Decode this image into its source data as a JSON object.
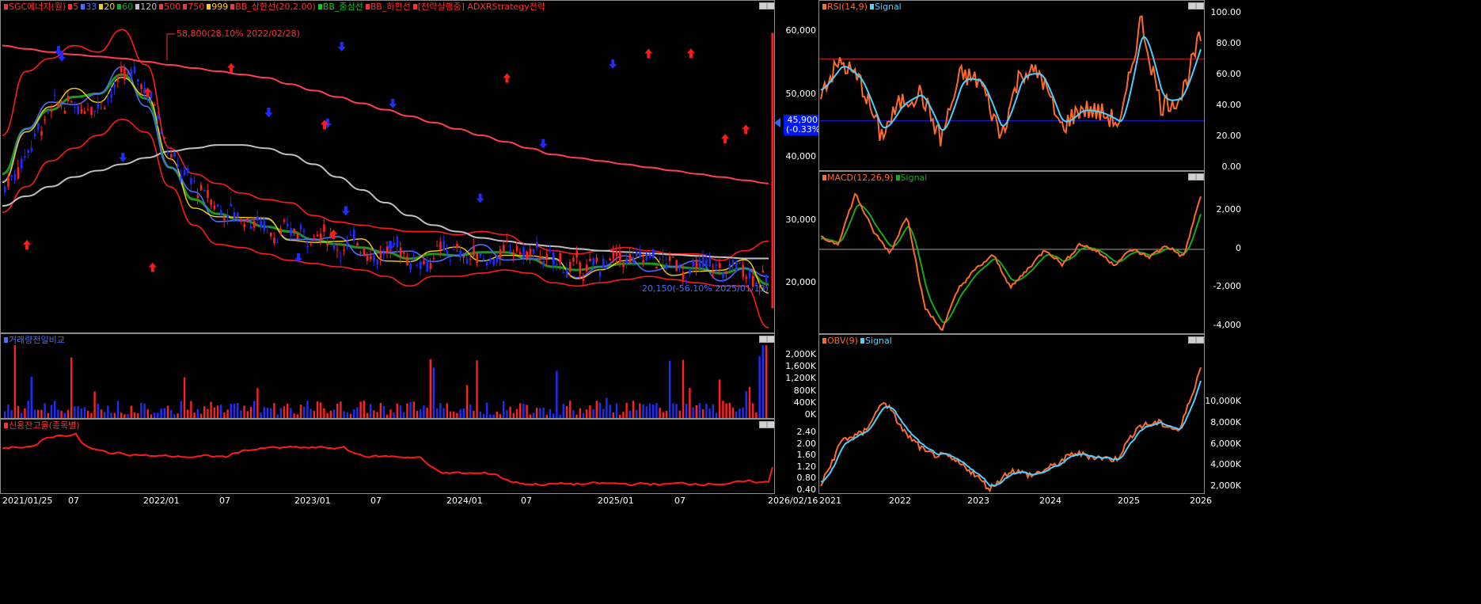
{
  "colors": {
    "up": "#ff2020",
    "down": "#1e2cff",
    "bb": "#ff1a1a",
    "grid_line": "#808080"
  },
  "price_panel": {
    "legend": [
      {
        "text": "SGC에너지(월)",
        "color": "#ff3030"
      },
      {
        "text": "5",
        "color": "#ff3030"
      },
      {
        "text": "33",
        "color": "#4a6bff"
      },
      {
        "text": "20",
        "color": "#ffd000"
      },
      {
        "text": "60",
        "color": "#18a818"
      },
      {
        "text": "120",
        "color": "#c0c0c0"
      },
      {
        "text": "500",
        "color": "#ff3030"
      },
      {
        "text": "750",
        "color": "#ff3030"
      },
      {
        "text": "999",
        "color": "#ffd000"
      },
      {
        "text": "BB_상한선(20,2.00)",
        "color": "#ff3030"
      },
      {
        "text": "BB_중심선",
        "color": "#18c818"
      },
      {
        "text": "BB_하한선",
        "color": "#ff3030"
      },
      {
        "text": "[전략실행중] ADXRStrategy전략",
        "color": "#ff3030"
      }
    ],
    "high_label": "58,800(28.10% 2022/02/28)",
    "low_label": "20,150(-56.10% 2025/01/13)",
    "current_price": "45,900",
    "current_change": "(-0.33%)",
    "y_ticks": [
      "60,000",
      "50,000",
      "40,000",
      "30,000",
      "20,000"
    ]
  },
  "volume_panel": {
    "legend": [
      {
        "text": "거래량전일비교",
        "color": "#4a6bff"
      }
    ],
    "y_ticks": [
      "2,000K",
      "1,600K",
      "1,200K",
      "800K",
      "400K",
      "0K"
    ]
  },
  "credit_panel": {
    "legend": [
      {
        "text": "신용잔고율(종목별)",
        "color": "#ff3030"
      }
    ],
    "y_ticks": [
      "2.40",
      "2.00",
      "1.60",
      "1.20",
      "0.80",
      "0.40"
    ]
  },
  "x_axis_left": [
    "2021/01/25",
    "07",
    "2022/01",
    "07",
    "2023/01",
    "07",
    "2024/01",
    "07",
    "2025/01",
    "07",
    "2026/02/16"
  ],
  "rsi_panel": {
    "legend": [
      {
        "text": "RSI(14,9)",
        "color": "#ff6a2a"
      },
      {
        "text": "Signal",
        "color": "#4ad0ff"
      }
    ],
    "y_ticks": [
      "100.00",
      "80.00",
      "60.00",
      "40.00",
      "20.00",
      "0.00"
    ]
  },
  "macd_panel": {
    "legend": [
      {
        "text": "MACD(12,26,9)",
        "color": "#ff6a2a"
      },
      {
        "text": "Signal",
        "color": "#18a818"
      }
    ],
    "y_ticks": [
      "2,000",
      "0",
      "-2,000",
      "-4,000"
    ]
  },
  "obv_panel": {
    "legend": [
      {
        "text": "OBV(9)",
        "color": "#ff6a2a"
      },
      {
        "text": "Signal",
        "color": "#4ad0ff"
      }
    ],
    "y_ticks": [
      "10,000K",
      "8,000K",
      "6,000K",
      "4,000K",
      "2,000K"
    ]
  },
  "x_axis_right": [
    "2021",
    "2022",
    "2023",
    "2024",
    "2025",
    "2026"
  ],
  "chart_data": [
    {
      "type": "line",
      "title": "SGC에너지(월)",
      "ylim": [
        13000,
        65000
      ],
      "series": [
        {
          "name": "BB_상한선(20,2.00)",
          "values": [
            44000,
            54000,
            56000,
            58000,
            57000,
            60500,
            55000,
            42000,
            38000,
            36500,
            35000,
            34000,
            33500,
            31500,
            30500,
            30000,
            29500,
            29000,
            29000,
            28500,
            29000,
            28500,
            27000,
            26000,
            25500,
            26000,
            26500,
            26000,
            25500,
            25500,
            24500,
            26000,
            27500
          ]
        },
        {
          "name": "BB_하한선",
          "values": [
            32000,
            36000,
            40000,
            42000,
            44000,
            46500,
            44500,
            36000,
            30000,
            27000,
            26500,
            25500,
            24500,
            24000,
            23500,
            23000,
            22000,
            20500,
            22000,
            22000,
            22500,
            23000,
            22500,
            21000,
            20500,
            21000,
            21500,
            22000,
            21500,
            21000,
            20500,
            20500,
            14000
          ]
        },
        {
          "name": "120",
          "values": [
            33000,
            34500,
            36000,
            37500,
            38500,
            39500,
            40500,
            41500,
            42000,
            42500,
            42500,
            42000,
            41000,
            39500,
            37500,
            35500,
            33500,
            31500,
            30000,
            29000,
            28000,
            27500,
            27000,
            26700,
            26300,
            26000,
            25800,
            25600,
            25400,
            25200,
            25000,
            24800,
            24800
          ]
        },
        {
          "name": "500",
          "values": [
            58000,
            57500,
            57000,
            56600,
            56300,
            56000,
            55500,
            55000,
            54500,
            54000,
            53500,
            53000,
            52000,
            51000,
            50000,
            49000,
            48000,
            47000,
            46000,
            45000,
            44000,
            43000,
            42000,
            41000,
            40500,
            40000,
            39500,
            39000,
            38500,
            38000,
            37500,
            37000,
            36500
          ]
        }
      ]
    },
    {
      "type": "bar",
      "title": "거래량전일비교",
      "ylim": [
        0,
        2400
      ],
      "note": "thousands of shares"
    },
    {
      "type": "line",
      "title": "신용잔고율(종목별)",
      "ylim": [
        0.4,
        2.6
      ]
    },
    {
      "type": "line",
      "title": "RSI(14,9)",
      "ylim": [
        0,
        100
      ]
    },
    {
      "type": "line",
      "title": "MACD(12,26,9)",
      "ylim": [
        -4000,
        3000
      ]
    },
    {
      "type": "line",
      "title": "OBV(9)",
      "ylim": [
        2000,
        11000
      ],
      "note": "thousands"
    }
  ]
}
